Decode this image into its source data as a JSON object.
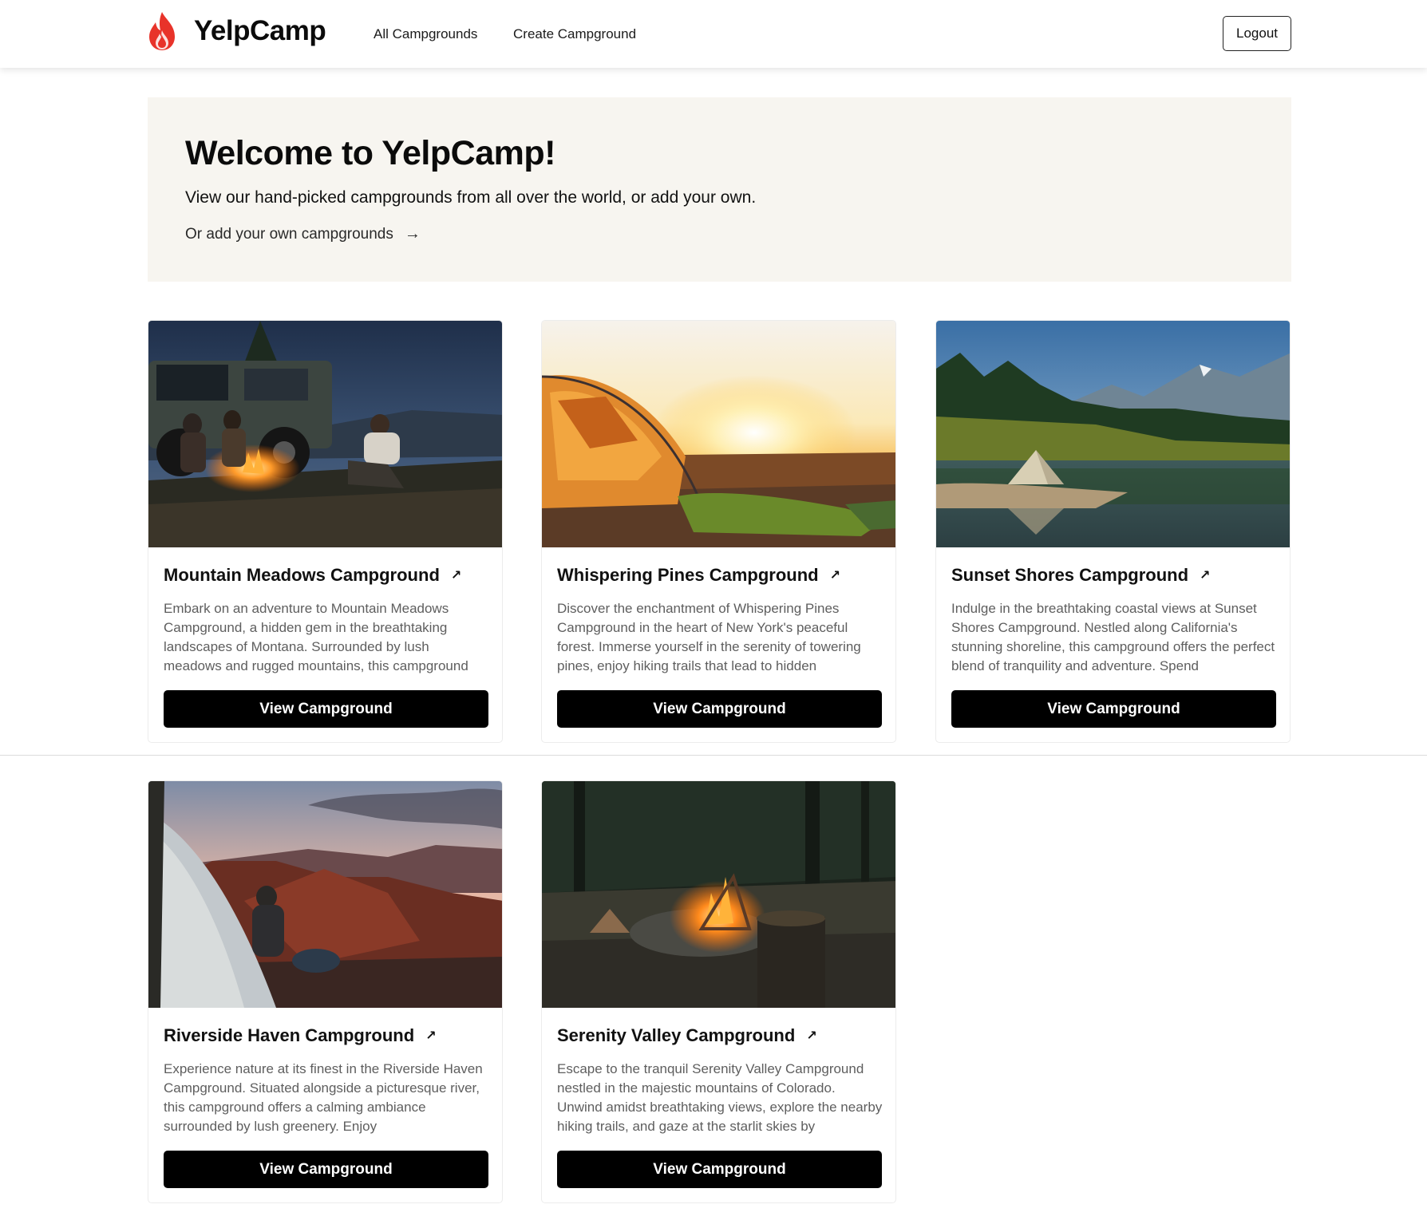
{
  "navbar": {
    "brand": "YelpCamp",
    "links": [
      "All Campgrounds",
      "Create Campground"
    ],
    "logout_label": "Logout"
  },
  "hero": {
    "title": "Welcome to YelpCamp!",
    "subtitle": "View our hand-picked campgrounds from all over the world, or add your own.",
    "link_text": "Or add your own campgrounds",
    "link_icon": "arrow-right-icon"
  },
  "campgrounds": [
    {
      "title": "Mountain Meadows Campground",
      "description": "Embark on an adventure to Mountain Meadows Campground, a hidden gem in the breathtaking landscapes of Montana. Surrounded by lush meadows and rugged mountains, this campground",
      "button": "View Campground",
      "image": "campfire-with-truck-at-dusk"
    },
    {
      "title": "Whispering Pines Campground",
      "description": "Discover the enchantment of Whispering Pines Campground in the heart of New York's peaceful forest. Immerse yourself in the serenity of towering pines, enjoy hiking trails that lead to hidden",
      "button": "View Campground",
      "image": "tent-at-sunset"
    },
    {
      "title": "Sunset Shores Campground",
      "description": "Indulge in the breathtaking coastal views at Sunset Shores Campground. Nestled along California's stunning shoreline, this campground offers the perfect blend of tranquility and adventure. Spend",
      "button": "View Campground",
      "image": "tent-by-mountain-lake"
    },
    {
      "title": "Riverside Haven Campground",
      "description": "Experience nature at its finest in the Riverside Haven Campground. Situated alongside a picturesque river, this campground offers a calming ambiance surrounded by lush greenery. Enjoy",
      "button": "View Campground",
      "image": "tent-overlooking-canyon"
    },
    {
      "title": "Serenity Valley Campground",
      "description": "Escape to the tranquil Serenity Valley Campground nestled in the majestic mountains of Colorado. Unwind amidst breathtaking views, explore the nearby hiking trails, and gaze at the starlit skies by",
      "button": "View Campground",
      "image": "campfire-in-forest"
    }
  ],
  "colors": {
    "brand_flame": "#e8332a",
    "hero_background": "#f7f5f0",
    "button_background": "#000000"
  }
}
